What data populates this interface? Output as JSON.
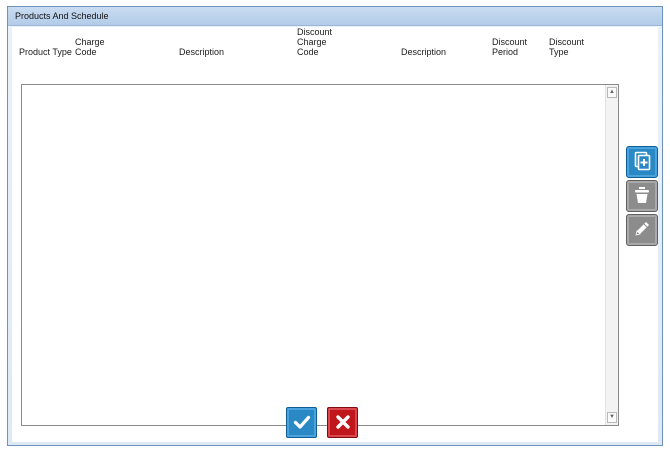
{
  "window": {
    "title": "Products And Schedule"
  },
  "table": {
    "columns": [
      "Product Type",
      "Charge\nCode",
      "Description",
      "Discount\nCharge\nCode",
      "Description",
      "Discount\nPeriod",
      "Discount\nType"
    ],
    "rows": []
  },
  "scrollbar": {
    "up_arrow": "▲",
    "down_arrow": "▼"
  },
  "side_toolbar": {
    "icons": [
      "add-document-icon",
      "trash-icon",
      "pencil-icon"
    ]
  },
  "dialog_buttons": {
    "icons": [
      "checkmark-icon",
      "close-icon"
    ]
  },
  "colors": {
    "accent_blue": "#2a89c5",
    "neutral_grey": "#8c8c8c",
    "cancel_red": "#c0171d",
    "title_bar": "#c2d7ef"
  }
}
